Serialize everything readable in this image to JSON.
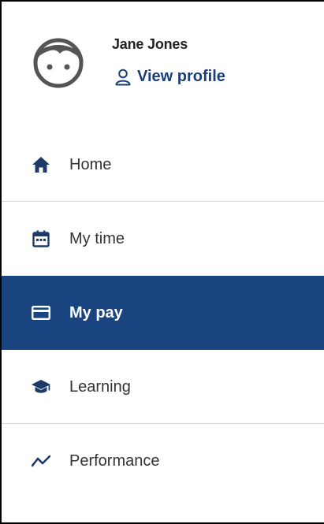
{
  "profile": {
    "name": "Jane Jones",
    "view_profile_label": "View profile",
    "avatar_icon": "avatar-face-icon",
    "link_icon": "person-outline-icon"
  },
  "nav": {
    "items": [
      {
        "label": "Home",
        "icon": "home-icon",
        "active": false
      },
      {
        "label": "My time",
        "icon": "calendar-icon",
        "active": false
      },
      {
        "label": "My pay",
        "icon": "credit-card-icon",
        "active": true
      },
      {
        "label": "Learning",
        "icon": "graduation-cap-icon",
        "active": false
      },
      {
        "label": "Performance",
        "icon": "trend-line-icon",
        "active": false
      }
    ]
  },
  "colors": {
    "accent": "#1a4480",
    "link": "#1a3f78",
    "icon": "#1e3a6b",
    "divider": "#d6d6d6",
    "avatar": "#555555"
  }
}
